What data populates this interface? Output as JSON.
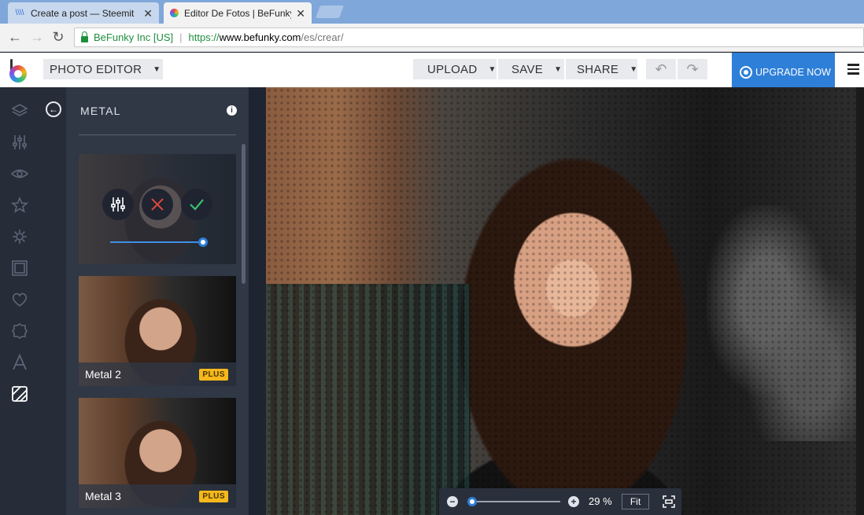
{
  "browser": {
    "tabs": [
      {
        "title": "Create a post — Steemit",
        "favicon": "steemit-icon"
      },
      {
        "title": "Editor De Fotos | BeFunky",
        "favicon": "befunky-icon"
      }
    ],
    "secure_label": "BeFunky Inc [US]",
    "url": {
      "scheme": "https://",
      "host": "www.befunky.com",
      "path": "/es/crear/"
    }
  },
  "header": {
    "photo_editor": "PHOTO EDITOR",
    "upload": "UPLOAD",
    "save": "SAVE",
    "share": "SHARE",
    "upgrade": "UPGRADE NOW",
    "accent": "#2e7fd8"
  },
  "rail": {
    "icons": [
      "layers-icon",
      "sliders-icon",
      "eye-icon",
      "star-icon",
      "gear-flower-icon",
      "frame-icon",
      "heart-icon",
      "badge-icon",
      "text-icon",
      "texture-icon"
    ]
  },
  "panel": {
    "title": "METAL",
    "effects": [
      {
        "label": "Metal 2",
        "badge": "PLUS"
      },
      {
        "label": "Metal 3",
        "badge": "PLUS"
      }
    ],
    "slider_value": 1.0,
    "badge_color": "#f5b81c"
  },
  "zoom": {
    "value": "29 %",
    "fit": "Fit",
    "slider_value": 0.0
  }
}
